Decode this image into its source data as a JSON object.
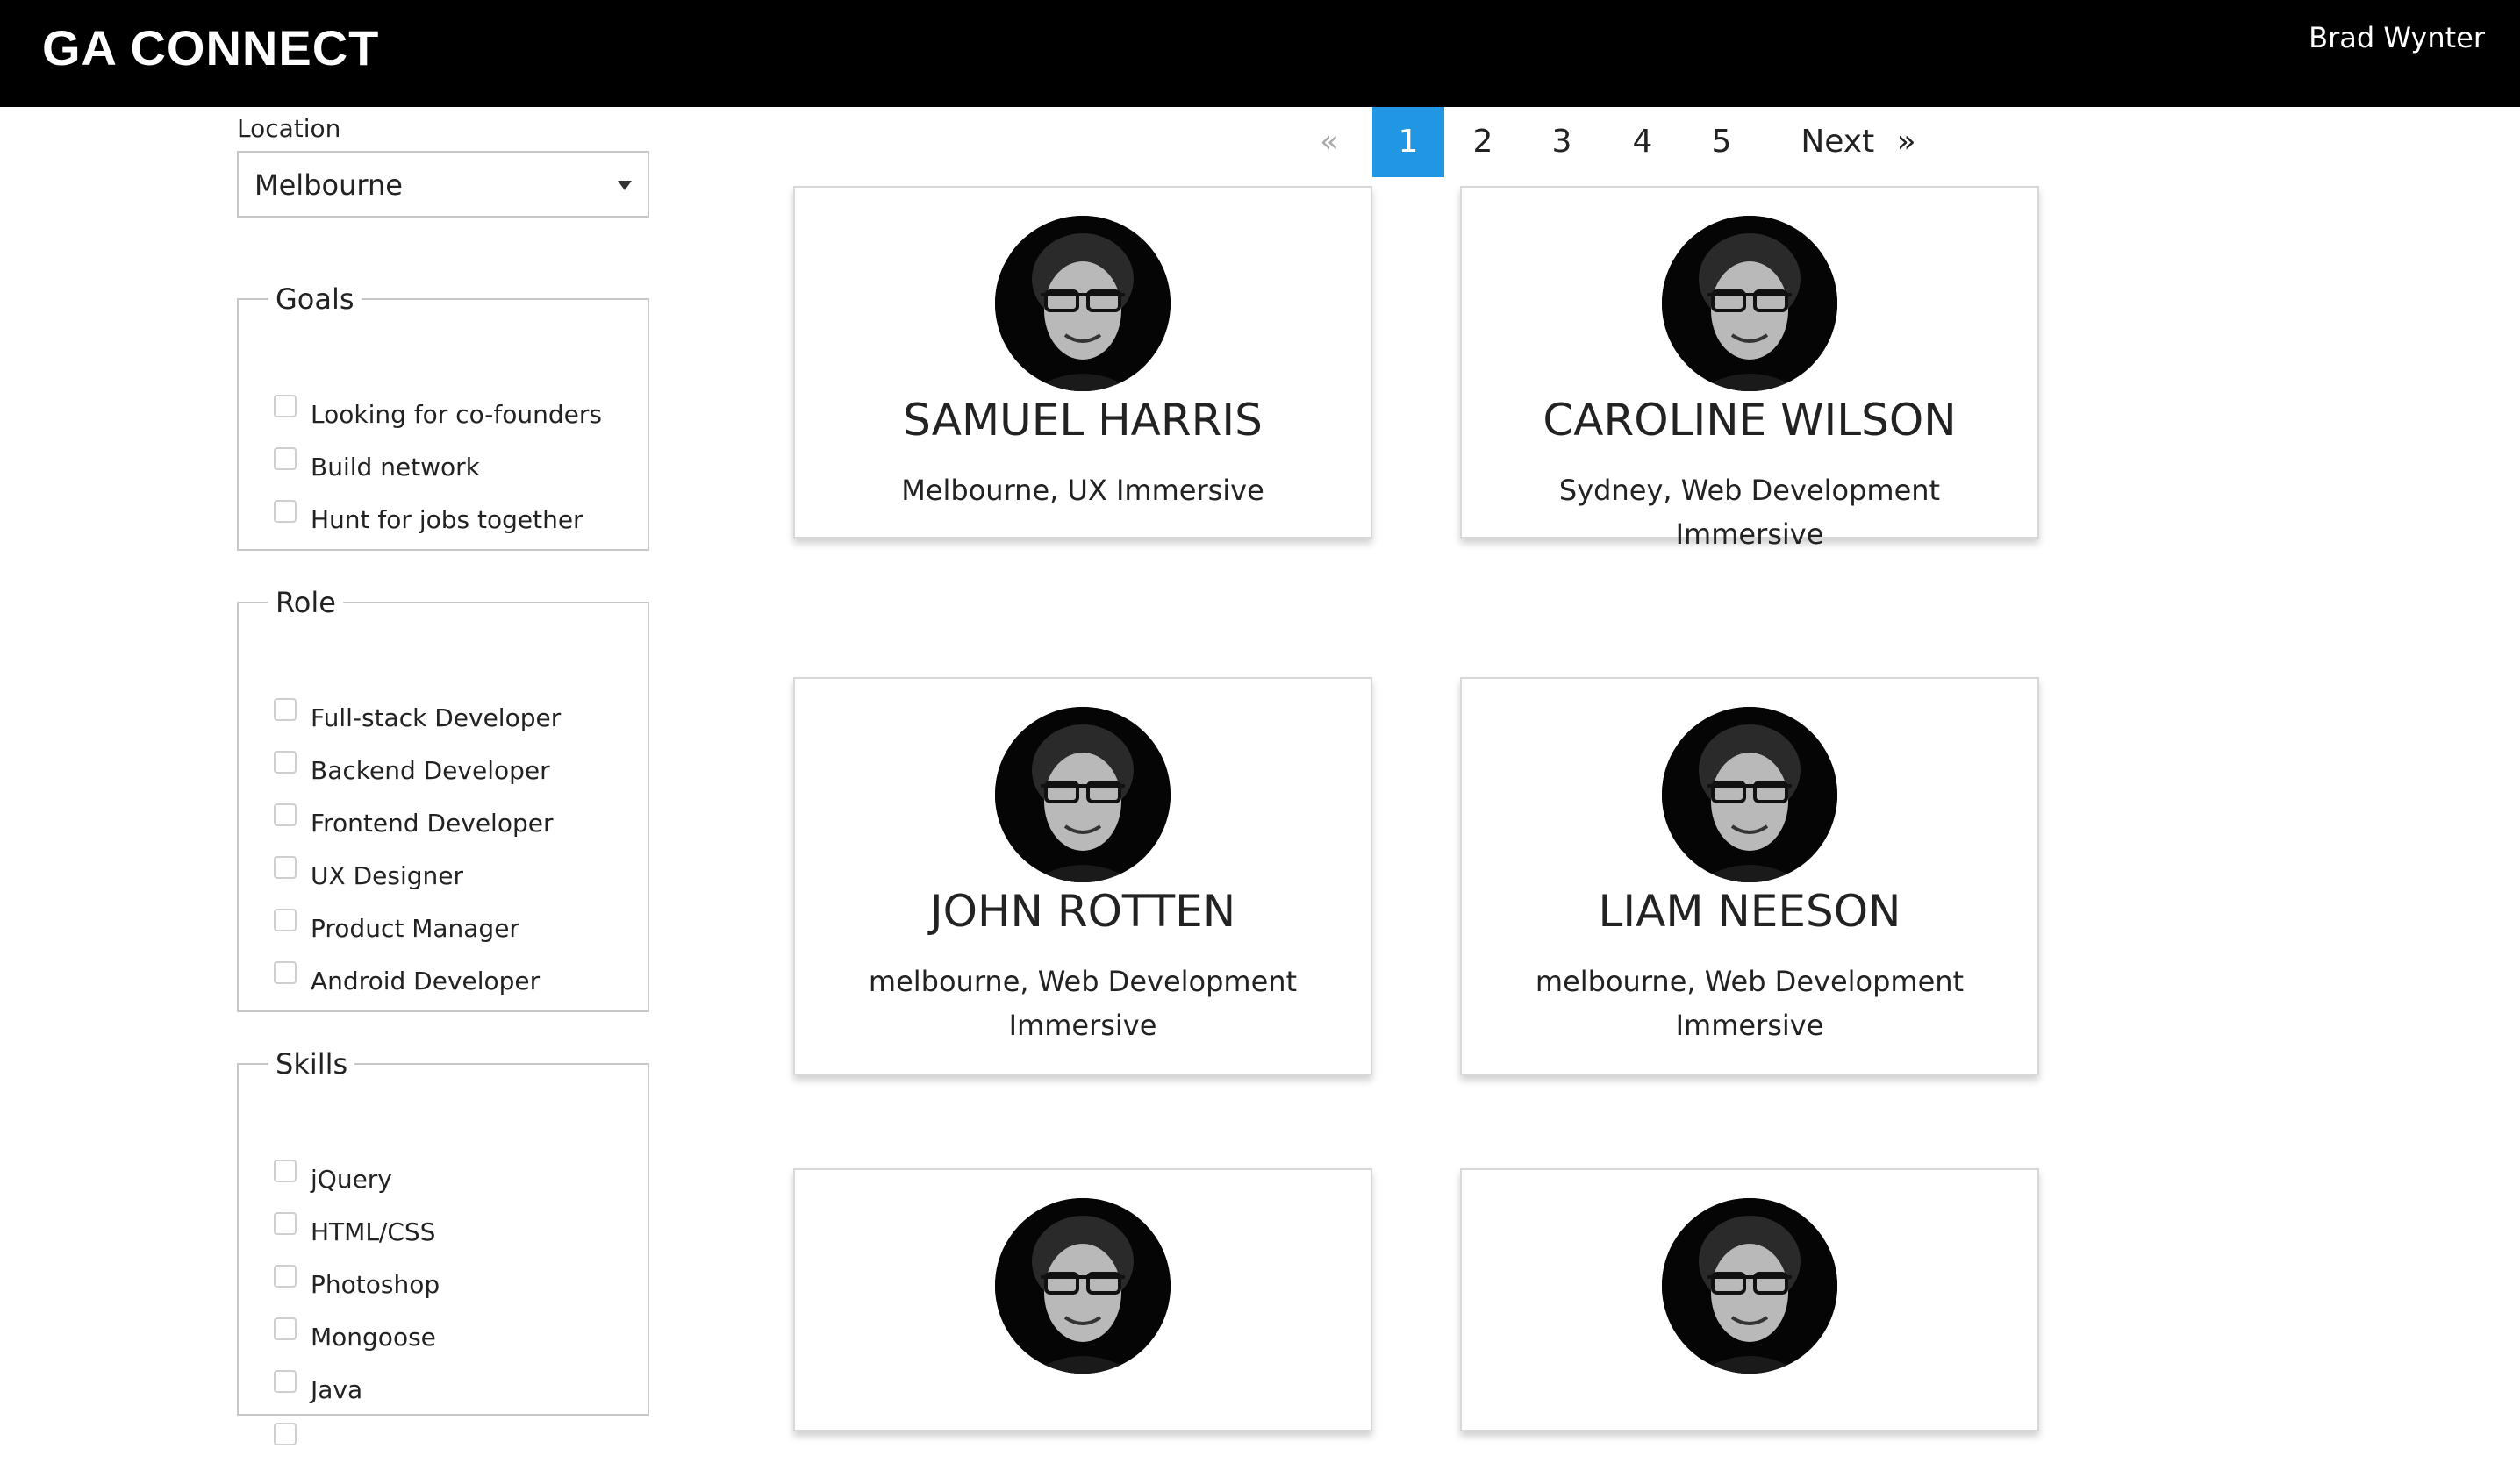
{
  "header": {
    "brand": "GA CONNECT",
    "user_name": "Brad Wynter"
  },
  "filters": {
    "location_label": "Location",
    "location_value": "Melbourne",
    "goals": {
      "legend": "Goals",
      "options": [
        "Looking for co-founders",
        "Build network",
        "Hunt for jobs together"
      ]
    },
    "role": {
      "legend": "Role",
      "options": [
        "Full-stack Developer",
        "Backend Developer",
        "Frontend Developer",
        "UX Designer",
        "Product Manager",
        "Android Developer"
      ]
    },
    "skills": {
      "legend": "Skills",
      "options": [
        "jQuery",
        "HTML/CSS",
        "Photoshop",
        "Mongoose",
        "Java"
      ]
    }
  },
  "pagination": {
    "prev": "«",
    "pages": [
      "1",
      "2",
      "3",
      "4",
      "5"
    ],
    "active_page": "1",
    "next": "Next",
    "next_arrow": "»",
    "active_color": "#2196e3"
  },
  "people": [
    {
      "name": "SAMUEL HARRIS",
      "subtitle": "Melbourne, UX Immersive"
    },
    {
      "name": "CAROLINE WILSON",
      "subtitle": "Sydney, Web Development Immersive"
    },
    {
      "name": "JOHN ROTTEN",
      "subtitle": "melbourne, Web Development Immersive"
    },
    {
      "name": "LIAM NEESON",
      "subtitle": "melbourne, Web Development Immersive"
    },
    {
      "name": "",
      "subtitle": ""
    },
    {
      "name": "",
      "subtitle": ""
    }
  ]
}
